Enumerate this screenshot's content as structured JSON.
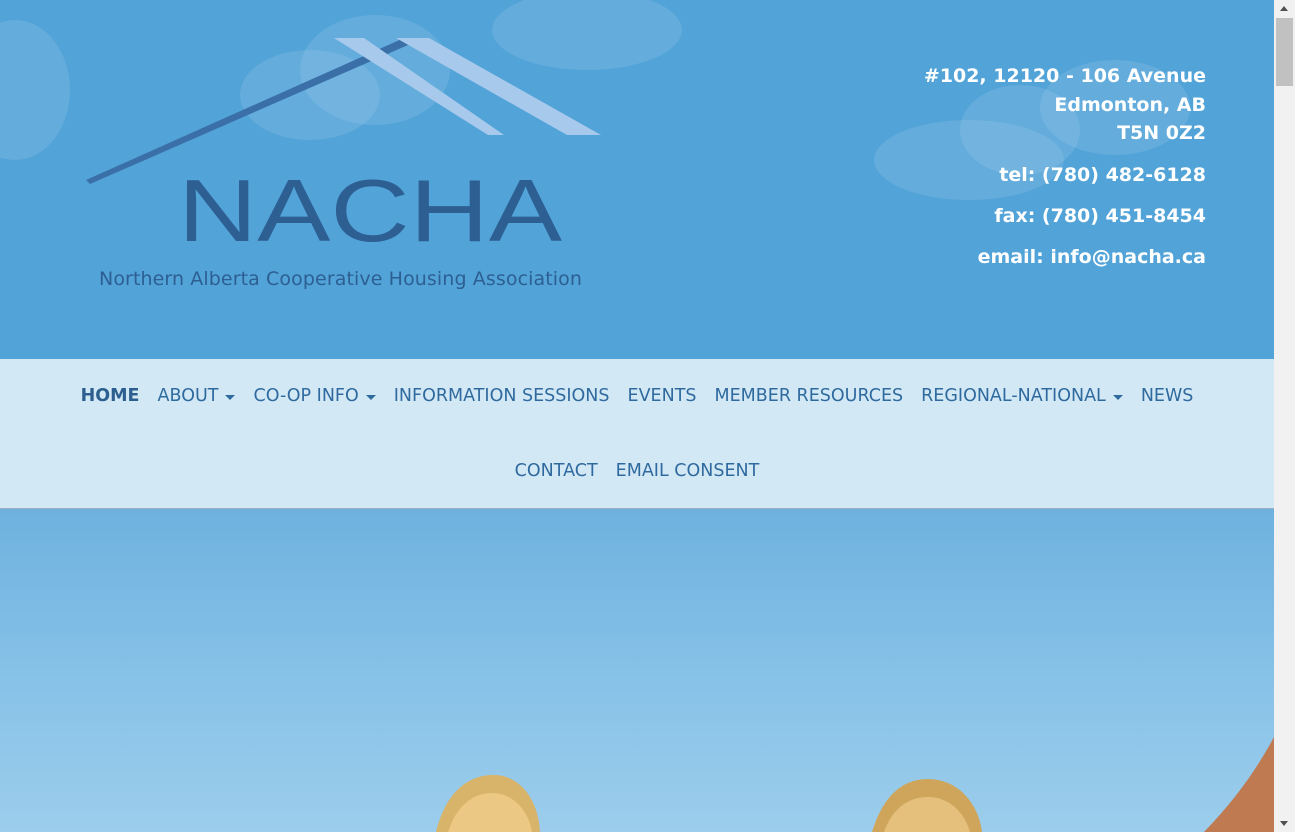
{
  "header": {
    "logo_word": "NACHA",
    "tagline": "Northern Alberta Cooperative Housing Association",
    "address": [
      "#102, 12120 - 106 Avenue",
      "Edmonton, AB",
      "T5N 0Z2"
    ],
    "tel": "tel: (780) 482-6128",
    "fax": "fax: (780) 451-8454",
    "email": "email: info@nacha.ca"
  },
  "nav": {
    "row1": [
      {
        "label": "HOME",
        "active": true
      },
      {
        "label": "ABOUT",
        "dropdown": true
      },
      {
        "label": "CO-OP INFO",
        "dropdown": true
      },
      {
        "label": "INFORMATION SESSIONS"
      },
      {
        "label": "EVENTS"
      },
      {
        "label": "MEMBER RESOURCES"
      },
      {
        "label": "REGIONAL-NATIONAL",
        "dropdown": true
      },
      {
        "label": "NEWS"
      }
    ],
    "row2": [
      {
        "label": "CONTACT"
      },
      {
        "label": "EMAIL CONSENT"
      }
    ]
  },
  "colors": {
    "header_bg": "#52a3d8",
    "nav_bg": "#d3e8f5",
    "nav_text": "#2f6a9f",
    "logo_dark": "#2d5f93",
    "logo_light": "#a6c9ec"
  },
  "icons": {
    "dropdown": "caret-down-icon",
    "scroll_up": "arrow-up-icon",
    "scroll_down": "arrow-down-icon"
  }
}
